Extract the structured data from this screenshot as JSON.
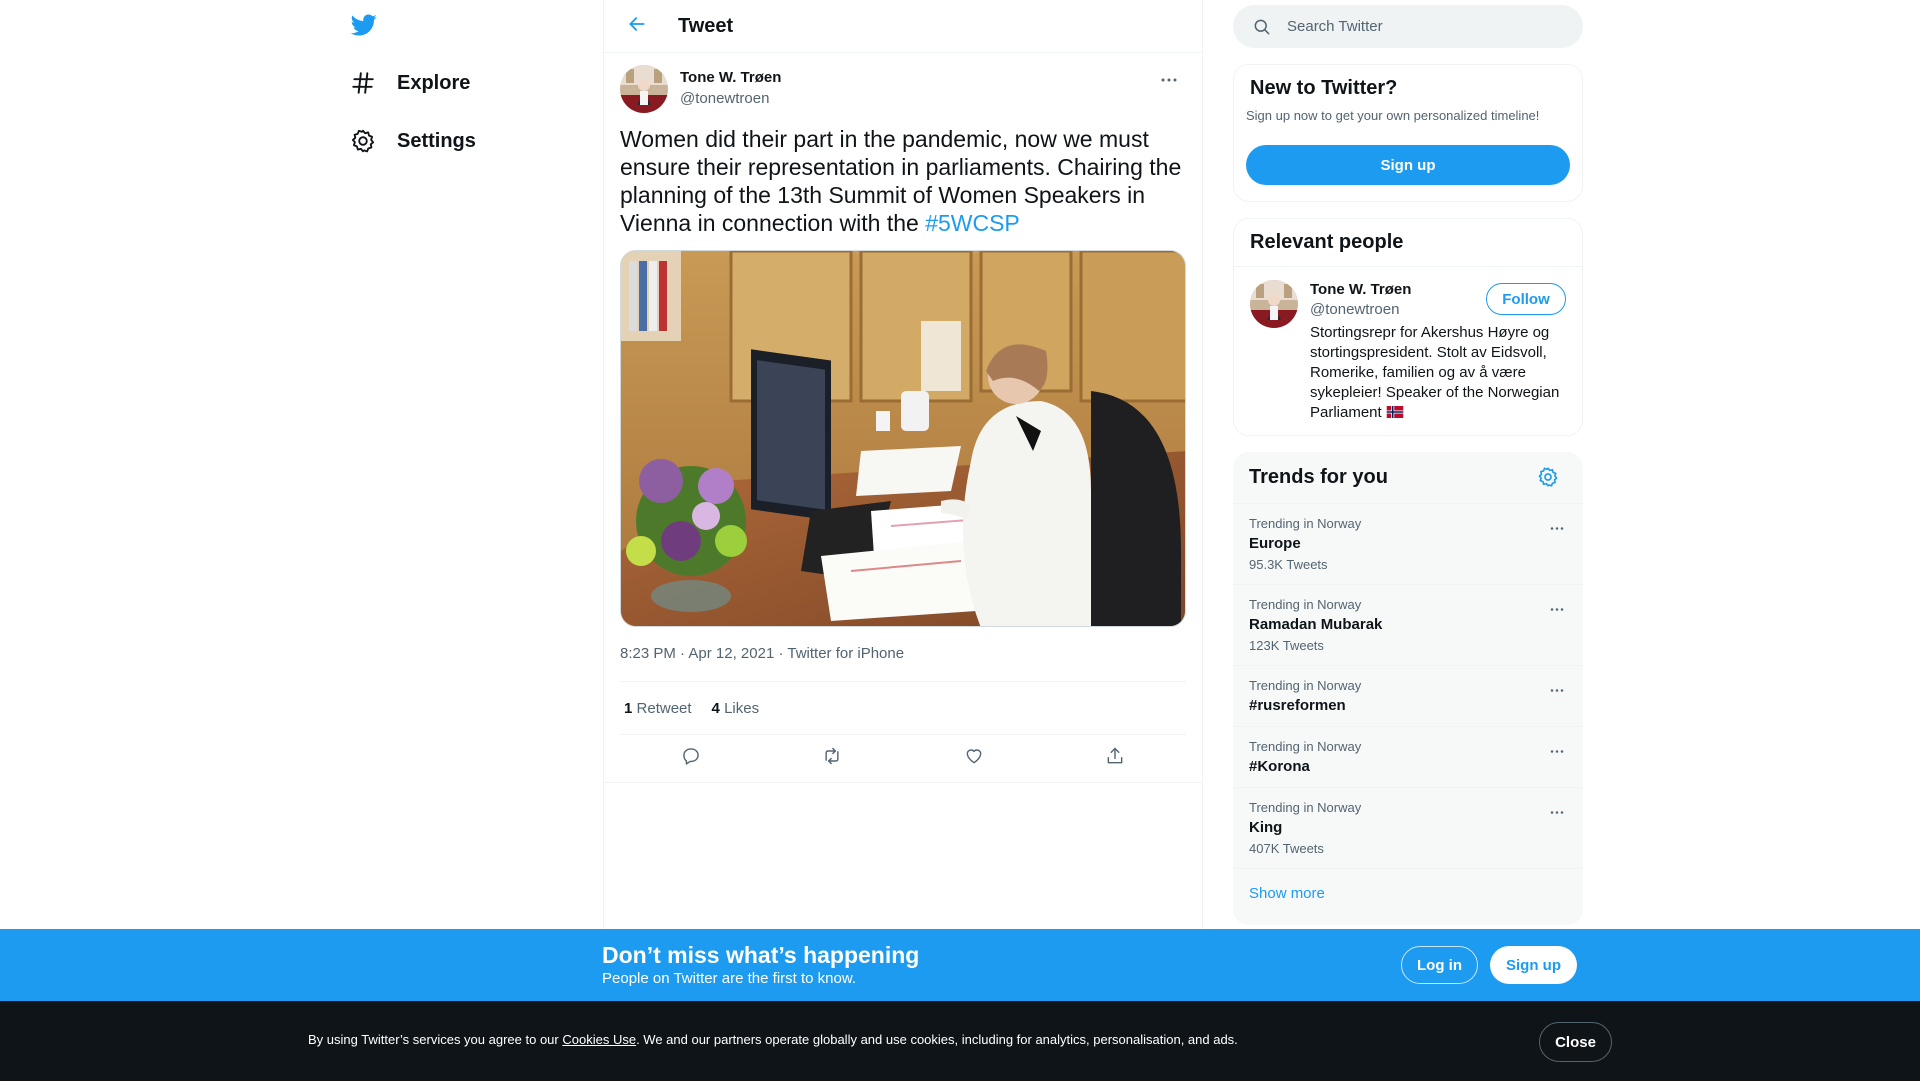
{
  "nav": {
    "logo_icon": "twitter-bird-icon",
    "items": [
      {
        "label": "Explore",
        "icon": "hash-icon"
      },
      {
        "label": "Settings",
        "icon": "gear-icon"
      }
    ]
  },
  "header": {
    "title": "Tweet",
    "back_icon": "arrow-left-icon"
  },
  "tweet": {
    "author_name": "Tone W. Trøen",
    "author_handle": "@tonewtroen",
    "text": "Women did their part in the pandemic, now we must ensure their representation in parliaments. Chairing the planning of the 13th Summit of Women Speakers in Vienna in connection with the ",
    "hashtag": "#5WCSP",
    "time": "8:23 PM",
    "separator": " · ",
    "date": "Apr 12, 2021",
    "source": "Twitter for iPhone",
    "retweets_count": "1",
    "retweets_label": "Retweet",
    "likes_count": "4",
    "likes_label": "Likes"
  },
  "search": {
    "placeholder": "Search Twitter"
  },
  "new_to_twitter": {
    "title": "New to Twitter?",
    "subtitle": "Sign up now to get your own personalized timeline!",
    "signup_label": "Sign up"
  },
  "relevant_people": {
    "title": "Relevant people",
    "name": "Tone W. Trøen",
    "handle": "@tonewtroen",
    "follow_label": "Follow",
    "bio": "Stortingsrepr for Akershus Høyre og stortingspresident. Stolt av Eidsvoll, Romerike, familien og av å være sykepleier! Speaker of the Norwegian Parliament "
  },
  "trends": {
    "title": "Trends for you",
    "items": [
      {
        "context": "Trending in Norway",
        "name": "Europe",
        "count": "95.3K Tweets"
      },
      {
        "context": "Trending in Norway",
        "name": "Ramadan Mubarak",
        "count": "123K Tweets"
      },
      {
        "context": "Trending in Norway",
        "name": "#rusreformen",
        "count": ""
      },
      {
        "context": "Trending in Norway",
        "name": "#Korona",
        "count": ""
      },
      {
        "context": "Trending in Norway",
        "name": "King",
        "count": "407K Tweets"
      }
    ],
    "show_more": "Show more"
  },
  "bottom_bar": {
    "title": "Don’t miss what’s happening",
    "subtitle": "People on Twitter are the first to know.",
    "login_label": "Log in",
    "signup_label": "Sign up"
  },
  "cookie": {
    "text_before": "By using Twitter’s services you agree to our ",
    "link": "Cookies Use",
    "text_after": ". We and our partners operate globally and use cookies, including for analytics, personalisation, and ads.",
    "close_label": "Close"
  },
  "colors": {
    "accent": "#1d9bf0",
    "text_primary": "#0f1419",
    "text_secondary": "#536471",
    "cookie_bg": "#0f1419"
  }
}
